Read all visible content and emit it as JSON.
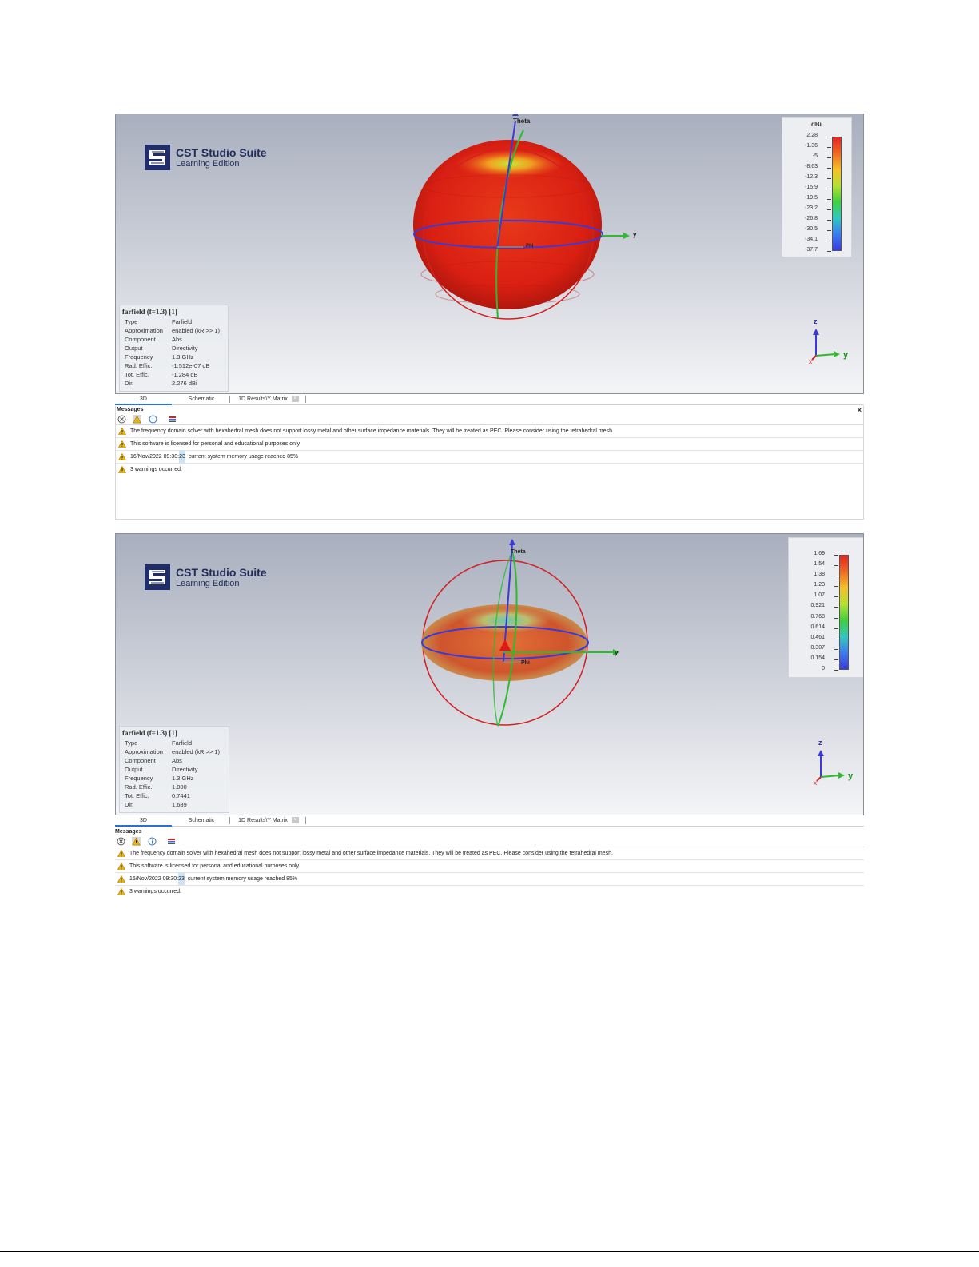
{
  "logo": {
    "title": "CST Studio Suite",
    "subtitle": "Learning Edition"
  },
  "panels": [
    {
      "info": {
        "title": "farfield (f=1.3) [1]",
        "rows": [
          {
            "k": "Type",
            "v": "Farfield"
          },
          {
            "k": "Approximation",
            "v": "enabled (kR >> 1)"
          },
          {
            "k": "Component",
            "v": "Abs"
          },
          {
            "k": "Output",
            "v": "Directivity"
          },
          {
            "k": "Frequency",
            "v": "1.3 GHz"
          },
          {
            "k": "Rad. Effic.",
            "v": "-1.512e-07 dB"
          },
          {
            "k": "Tot. Effic.",
            "v": "-1.284 dB"
          },
          {
            "k": "Dir.",
            "v": "2.276 dBi"
          }
        ]
      },
      "legend": {
        "unit": "dBi",
        "ticks": [
          "2.28",
          "-1.36",
          "-5",
          "-8.63",
          "-12.3",
          "-15.9",
          "-19.5",
          "-23.2",
          "-26.8",
          "-30.5",
          "-34.1",
          "-37.7"
        ]
      },
      "axes": {
        "theta": "Theta",
        "phi": "Phi",
        "y": "y",
        "z": "z"
      }
    },
    {
      "info": {
        "title": "farfield (f=1.3) [1]",
        "rows": [
          {
            "k": "Type",
            "v": "Farfield"
          },
          {
            "k": "Approximation",
            "v": "enabled (kR >> 1)"
          },
          {
            "k": "Component",
            "v": "Abs"
          },
          {
            "k": "Output",
            "v": "Directivity"
          },
          {
            "k": "Frequency",
            "v": "1.3 GHz"
          },
          {
            "k": "Rad. Effic.",
            "v": "1.000"
          },
          {
            "k": "Tot. Effic.",
            "v": "0.7441"
          },
          {
            "k": "Dir.",
            "v": "1.689"
          }
        ]
      },
      "legend": {
        "unit": "",
        "ticks": [
          "1.69",
          "1.54",
          "1.38",
          "1.23",
          "1.07",
          "0.921",
          "0.768",
          "0.614",
          "0.461",
          "0.307",
          "0.154",
          "0"
        ]
      },
      "axes": {
        "theta": "Theta",
        "phi": "Phi",
        "y": "y",
        "z": "z"
      }
    }
  ],
  "tabs": [
    {
      "label": "3D"
    },
    {
      "label": "Schematic"
    },
    {
      "label": "1D Results\\Y Matrix"
    }
  ],
  "messages": {
    "title": "Messages",
    "close": "×",
    "rows": [
      {
        "pre": "The frequency domain solver with hexahedral mesh does not support lossy metal and other surface impedance materials. They will be treated as PEC. Please consider using the tetrahedral mesh.",
        "hl": "",
        "post": ""
      },
      {
        "pre": "This software is licensed for personal and educational purposes only.",
        "hl": "",
        "post": ""
      },
      {
        "pre": "16/Nov/2022 09:30:",
        "hl": "23",
        "post": "  current system memory usage reached 85%"
      },
      {
        "pre": "3 warnings occurred.",
        "hl": "",
        "post": ""
      }
    ]
  },
  "colors": {
    "accent": "#2a6fd1",
    "warning": "#f2b705",
    "theta_axis": "#3a3ad6",
    "phi_axis": "#2dbb2d",
    "ring": "#d42020"
  }
}
